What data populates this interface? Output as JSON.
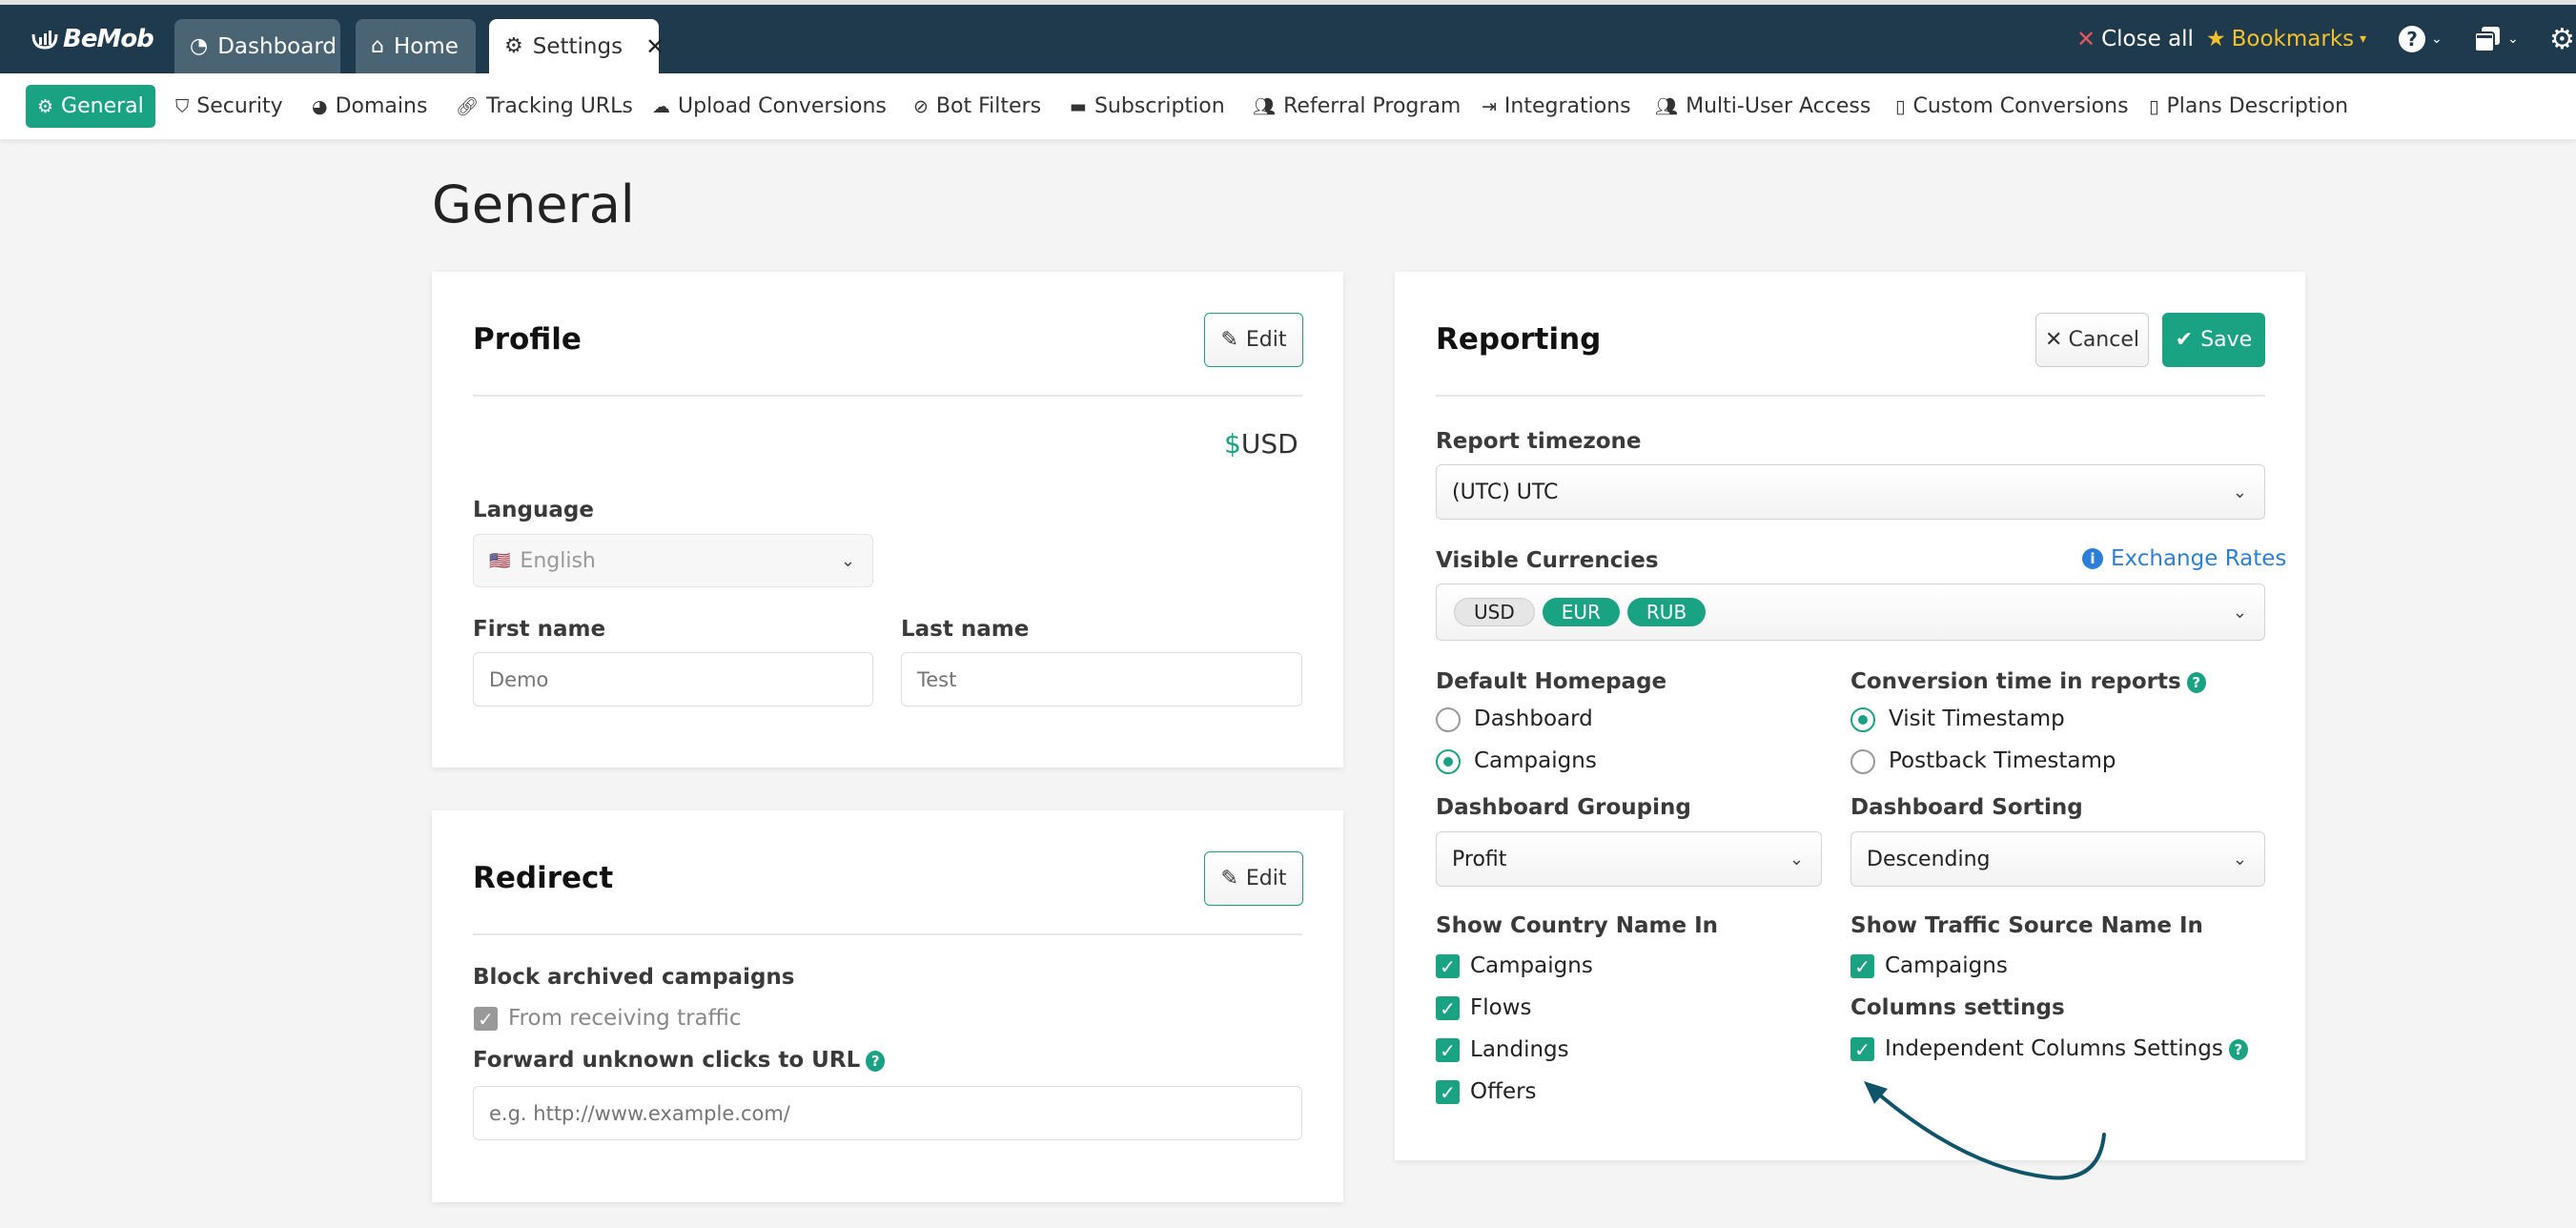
{
  "header": {
    "logo": "BeMob",
    "tabs": [
      {
        "label": "Dashboard",
        "icon": "dashboard-gauge-icon"
      },
      {
        "label": "Home",
        "icon": "home-icon"
      },
      {
        "label": "Settings",
        "icon": "gear-icon",
        "active": true,
        "closable": true
      }
    ],
    "close_all": "Close all",
    "bookmarks": "Bookmarks"
  },
  "subnav": {
    "items": [
      {
        "label": "General",
        "icon": "gear-icon",
        "active": true
      },
      {
        "label": "Security",
        "icon": "shield-icon"
      },
      {
        "label": "Domains",
        "icon": "globe-icon"
      },
      {
        "label": "Tracking URLs",
        "icon": "link-icon"
      },
      {
        "label": "Upload Conversions",
        "icon": "cloud-upload-icon"
      },
      {
        "label": "Bot Filters",
        "icon": "ban-icon"
      },
      {
        "label": "Subscription",
        "icon": "credit-card-icon"
      },
      {
        "label": "Referral Program",
        "icon": "users-icon"
      },
      {
        "label": "Integrations",
        "icon": "file-import-icon"
      },
      {
        "label": "Multi-User Access",
        "icon": "users-cog-icon"
      },
      {
        "label": "Custom Conversions",
        "icon": "file-invoice-dollar-icon"
      },
      {
        "label": "Plans Description",
        "icon": "file-chart-icon"
      }
    ]
  },
  "page": {
    "title": "General"
  },
  "profile": {
    "title": "Profile",
    "edit": "Edit",
    "currency_symbol": "$",
    "currency": "USD",
    "language_label": "Language",
    "language_value": "English",
    "language_flag": "🇺🇸",
    "first_name_label": "First name",
    "first_name_placeholder": "Demo",
    "last_name_label": "Last name",
    "last_name_placeholder": "Test"
  },
  "redirect": {
    "title": "Redirect",
    "edit": "Edit",
    "block_label": "Block archived campaigns",
    "block_option": "From receiving traffic",
    "block_checked": true,
    "forward_label": "Forward unknown clicks to URL",
    "forward_placeholder": "e.g. http://www.example.com/"
  },
  "reporting": {
    "title": "Reporting",
    "cancel": "Cancel",
    "save": "Save",
    "timezone_label": "Report timezone",
    "timezone_value": "(UTC) UTC",
    "currencies_label": "Visible Currencies",
    "exchange_rates": "Exchange Rates",
    "currencies": [
      {
        "code": "USD",
        "state": "default"
      },
      {
        "code": "EUR",
        "state": "selected"
      },
      {
        "code": "RUB",
        "state": "selected"
      }
    ],
    "homepage_label": "Default Homepage",
    "homepage_options": [
      {
        "label": "Dashboard",
        "selected": false
      },
      {
        "label": "Campaigns",
        "selected": true
      }
    ],
    "conversion_label": "Conversion time in reports",
    "conversion_options": [
      {
        "label": "Visit Timestamp",
        "selected": true
      },
      {
        "label": "Postback Timestamp",
        "selected": false
      }
    ],
    "grouping_label": "Dashboard Grouping",
    "grouping_value": "Profit",
    "sorting_label": "Dashboard Sorting",
    "sorting_value": "Descending",
    "country_label": "Show Country Name In",
    "country_options": [
      {
        "label": "Campaigns",
        "checked": true
      },
      {
        "label": "Flows",
        "checked": true
      },
      {
        "label": "Landings",
        "checked": true
      },
      {
        "label": "Offers",
        "checked": true
      }
    ],
    "traffic_label": "Show Traffic Source Name In",
    "traffic_options": [
      {
        "label": "Campaigns",
        "checked": true
      }
    ],
    "columns_label": "Columns settings",
    "columns_options": [
      {
        "label": "Independent Columns Settings",
        "checked": true
      }
    ]
  },
  "colors": {
    "brand_dark": "#1e3a4c",
    "accent": "#1aa383",
    "bookmarks": "#f2c12e",
    "close_all_x": "#e0595e",
    "link": "#2c7fd8",
    "annotation_arrow": "#0f5468"
  }
}
